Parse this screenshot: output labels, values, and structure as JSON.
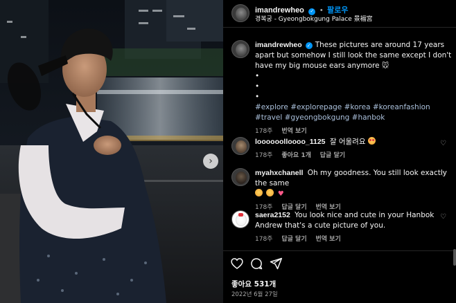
{
  "post": {
    "username": "imandrewheo",
    "follow_label": "팔로우",
    "separator": "•",
    "location": "경복궁 - Gyeongbokgung Palace 景福宮"
  },
  "caption": {
    "username": "imandrewheo",
    "text": "These pictures are around 17 years apart but somehow I still look the same except I don't have my big mouse ears anymore",
    "emoji": "mouse",
    "bullets": [
      "•",
      "•",
      "•"
    ],
    "hashtags": [
      "#explore",
      "#explorepage",
      "#korea",
      "#koreanfashion",
      "#travel",
      "#gyeongbokgung",
      "#hanbok"
    ],
    "time": "178주",
    "translate_label": "번역 보기"
  },
  "comments": [
    {
      "username": "loooooolloooo_1125",
      "text": "잘 어울려요",
      "emoji": "heart-eyes",
      "time": "178주",
      "likes_label": "좋아요 1개",
      "reply_label": "답글 달기"
    },
    {
      "username": "myahxchanell",
      "text": "Oh my goodness. You still look exactly the same",
      "emoji": [
        "crying-face",
        "crying-face",
        "heart"
      ],
      "time": "178주",
      "reply_label": "답글 달기",
      "translate_label": "번역 보기"
    },
    {
      "username": "saera2152",
      "text": "You look nice and cute in your Hanbok Andrew that's a cute picture of you.",
      "time": "178주",
      "reply_label": "답글 달기",
      "translate_label": "번역 보기"
    }
  ],
  "actions": {
    "icons": [
      "heart-icon",
      "comment-icon",
      "share-icon"
    ]
  },
  "likes": "좋아요 531개",
  "date": "2022년 6월 27일",
  "colors": {
    "background": "#000000",
    "link_blue": "#0095f6",
    "muted": "#a8a8a8",
    "text": "#f5f5f5"
  }
}
